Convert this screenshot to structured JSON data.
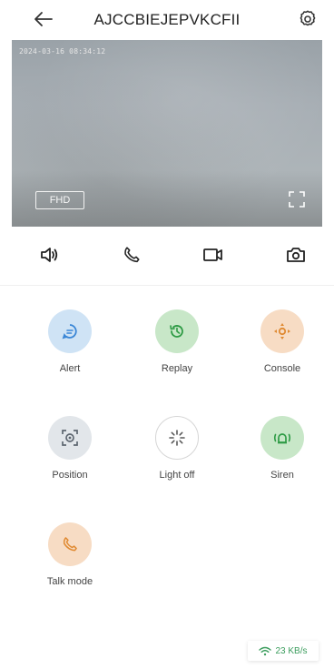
{
  "header": {
    "title": "AJCCBIEJEPVKCFII",
    "back_icon": "arrow-left-icon",
    "settings_icon": "gear-icon"
  },
  "video": {
    "timestamp": "2024-03-16 08:34:12",
    "quality_label": "FHD",
    "fullscreen_icon": "fullscreen-icon"
  },
  "controls": [
    {
      "name": "speaker",
      "icon": "speaker-icon"
    },
    {
      "name": "call",
      "icon": "phone-icon"
    },
    {
      "name": "record",
      "icon": "video-record-icon"
    },
    {
      "name": "snapshot",
      "icon": "camera-icon"
    }
  ],
  "features": {
    "alert": {
      "label": "Alert",
      "icon": "message-icon",
      "color": "#cfe3f5",
      "icon_color": "#3a86d6"
    },
    "replay": {
      "label": "Replay",
      "icon": "history-icon",
      "color": "#c8e7c8",
      "icon_color": "#2e9b45"
    },
    "console": {
      "label": "Console",
      "icon": "ptz-control-icon",
      "color": "#f7dcc4",
      "icon_color": "#e08a32"
    },
    "position": {
      "label": "Position",
      "icon": "target-icon",
      "color": "#e2e6ea",
      "icon_color": "#5d6670"
    },
    "light_off": {
      "label": "Light off",
      "icon": "light-icon",
      "color": "#ffffff",
      "icon_color": "#5a5a5a"
    },
    "siren": {
      "label": "Siren",
      "icon": "siren-icon",
      "color": "#c8e7c8",
      "icon_color": "#2e9b45"
    },
    "talk_mode": {
      "label": "Talk mode",
      "icon": "phone-icon",
      "color": "#f7dcc4",
      "icon_color": "#e08a32"
    }
  },
  "network": {
    "speed": "23 KB/s",
    "icon": "wifi-icon",
    "color": "#3b9d5d"
  }
}
